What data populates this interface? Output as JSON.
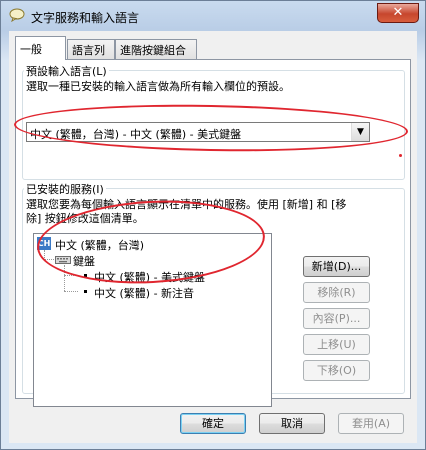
{
  "window": {
    "title": "文字服務和輸入語言",
    "close_glyph": "✕"
  },
  "tabs": [
    {
      "label": "一般",
      "active": true
    },
    {
      "label": "語言列",
      "active": false
    },
    {
      "label": "進階按鍵組合",
      "active": false
    }
  ],
  "default_language": {
    "group_label": "預設輸入語言(L)",
    "description": "選取一種已安裝的輸入語言做為所有輸入欄位的預設。",
    "selected": "中文 (繁體，台灣) - 中文 (繁體) - 美式鍵盤"
  },
  "installed_services": {
    "group_label": "已安裝的服務(I)",
    "description_line1": "選取您要為每個輸入語言顯示在清單中的服務。使用 [新增] 和 [移",
    "description_line2": "除] 按鈕修改這個清單。",
    "tree": {
      "language_icon": "CH",
      "language": "中文 (繁體，台灣)",
      "category": "鍵盤",
      "items": [
        "中文 (繁體) - 美式鍵盤",
        "中文 (繁體) - 新注音"
      ]
    },
    "buttons": {
      "add": "新增(D)...",
      "remove": "移除(R)",
      "properties": "內容(P)...",
      "move_up": "上移(U)",
      "move_down": "下移(O)"
    }
  },
  "footer": {
    "ok": "確定",
    "cancel": "取消",
    "apply": "套用(A)"
  },
  "icons": {
    "app": "speech-bubble-icon",
    "keyboard": "keyboard-icon",
    "dropdown": "chevron-down-icon"
  },
  "colors": {
    "annotation": "#e0262f",
    "language_badge": "#3b7ac6"
  }
}
